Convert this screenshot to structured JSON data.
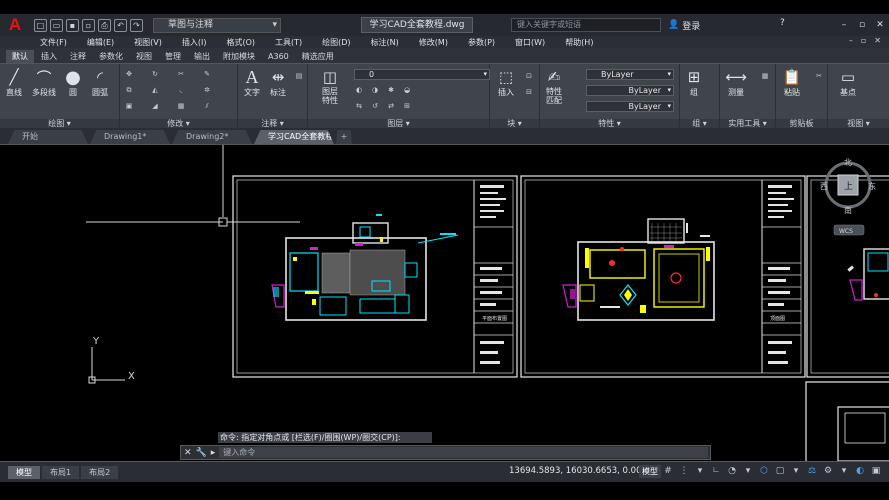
{
  "app": {
    "logo": "A",
    "title": "学习CAD全套教程.dwg",
    "workspace": "草图与注释"
  },
  "search": {
    "placeholder": "键入关键字或短语"
  },
  "user": {
    "label": "登录"
  },
  "menu": [
    "文件(F)",
    "编辑(E)",
    "视图(V)",
    "插入(I)",
    "格式(O)",
    "工具(T)",
    "绘图(D)",
    "标注(N)",
    "修改(M)",
    "参数(P)",
    "窗口(W)",
    "帮助(H)"
  ],
  "ribbon_tabs": [
    "默认",
    "插入",
    "注释",
    "参数化",
    "视图",
    "管理",
    "输出",
    "附加模块",
    "A360",
    "精选应用"
  ],
  "ribbon": {
    "draw_tools": [
      "直线",
      "多段线",
      "圆",
      "圆弧"
    ],
    "text": "文字",
    "dim": "标注",
    "layer_props": "图层\n特性",
    "insert": "插入",
    "match": "特性\n匹配",
    "group": "组",
    "measure": "测量",
    "paste": "粘贴",
    "base": "基点",
    "layer_value": "0",
    "bylayer": [
      "ByLayer",
      "ByLayer",
      "ByLayer"
    ],
    "panel_titles": [
      "绘图 ▾",
      "修改 ▾",
      "注释 ▾",
      "图层 ▾",
      "块 ▾",
      "特性 ▾",
      "组 ▾",
      "实用工具 ▾",
      "剪贴板",
      "视图 ▾"
    ]
  },
  "file_tabs": [
    "开始",
    "Drawing1*",
    "Drawing2*",
    "学习CAD全套教程*"
  ],
  "viewcube": {
    "north": "北",
    "south": "南",
    "west": "西",
    "east": "东",
    "top": "上",
    "wcs": "WCS"
  },
  "ucs": {
    "x": "X",
    "y": "Y"
  },
  "sheets": [
    "平面布置图",
    "顶面图"
  ],
  "command": {
    "history": "命令: 指定对角点或 [栏选(F)/圈围(WP)/圈交(CP)]:",
    "placeholder": "键入命令"
  },
  "layout_tabs": [
    "模型",
    "布局1",
    "布局2"
  ],
  "status": {
    "coords": "13694.5893, 16030.6653, 0.0000",
    "mode": "模型"
  },
  "colors": {
    "accent": "#1f73d6",
    "cyan": "#00e5ff",
    "yellow": "#ffff00",
    "magenta": "#d11fd1",
    "red": "#ff2a2a"
  }
}
